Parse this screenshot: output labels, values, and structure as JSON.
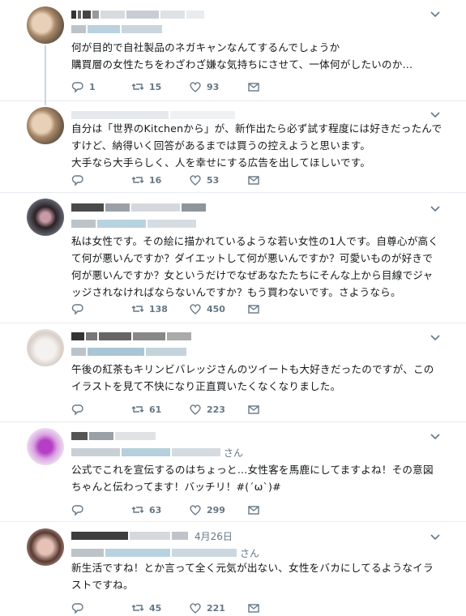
{
  "replies": [
    {
      "text": "何が目的で自社製品のネガキャンなんてするんでしょうか\n購買層の女性たちをわざわざ嫌な気持ちにさせて、一体何がしたいのか…",
      "replies": "1",
      "retweets": "15",
      "likes": "93"
    },
    {
      "text": "自分は「世界のKitchenから」が、新作出たら必ず試す程度には好きだったんで\nすけど、納得いく回答があるまでは買うの控えようと思います。\n大手なら大手らしく、人を幸せにする広告を出してほしいです。",
      "replies": "",
      "retweets": "16",
      "likes": "53"
    },
    {
      "text": "私は女性です。その絵に描かれているような若い女性の1人です。自尊心が高く\nて何が悪いんですか？ダイエットして何が悪いんですか？可愛いものが好きで\n何が悪いんですか？女というだけでなぜあなたたちにそんな上から目線でジャ\nッジされなければならないんですか？もう買わないです。さようなら。",
      "replies": "",
      "retweets": "138",
      "likes": "450"
    },
    {
      "text": "午後の紅茶もキリンビバレッジさんのツイートも大好きだったのですが、この\nイラストを見て不快になり正直買いたくなくなりました。",
      "replies": "",
      "retweets": "61",
      "likes": "223"
    },
    {
      "handle_suffix": "さん",
      "text": "公式でこれを宣伝するのはちょっと…女性客を馬鹿にしてますよね！その意図\nちゃんと伝わってます！バッチリ！#(ˊωˋ)#",
      "replies": "",
      "retweets": "63",
      "likes": "299"
    },
    {
      "timestamp": "4月26日",
      "handle_suffix": "さん",
      "text": "新生活ですね！とか言って全く元気が出ない、女性をバカにしてるようなイラ\nストですね。",
      "replies": "",
      "retweets": "45",
      "likes": "221"
    }
  ],
  "icons": {
    "reply": "reply-icon",
    "retweet": "retweet-icon",
    "like": "heart-icon",
    "dm": "envelope-icon",
    "more": "chevron-down-icon"
  },
  "colors": {
    "text": "#14171a",
    "meta": "#657786",
    "divider": "#e6ecf0",
    "thread_line": "#ccd6dd"
  }
}
